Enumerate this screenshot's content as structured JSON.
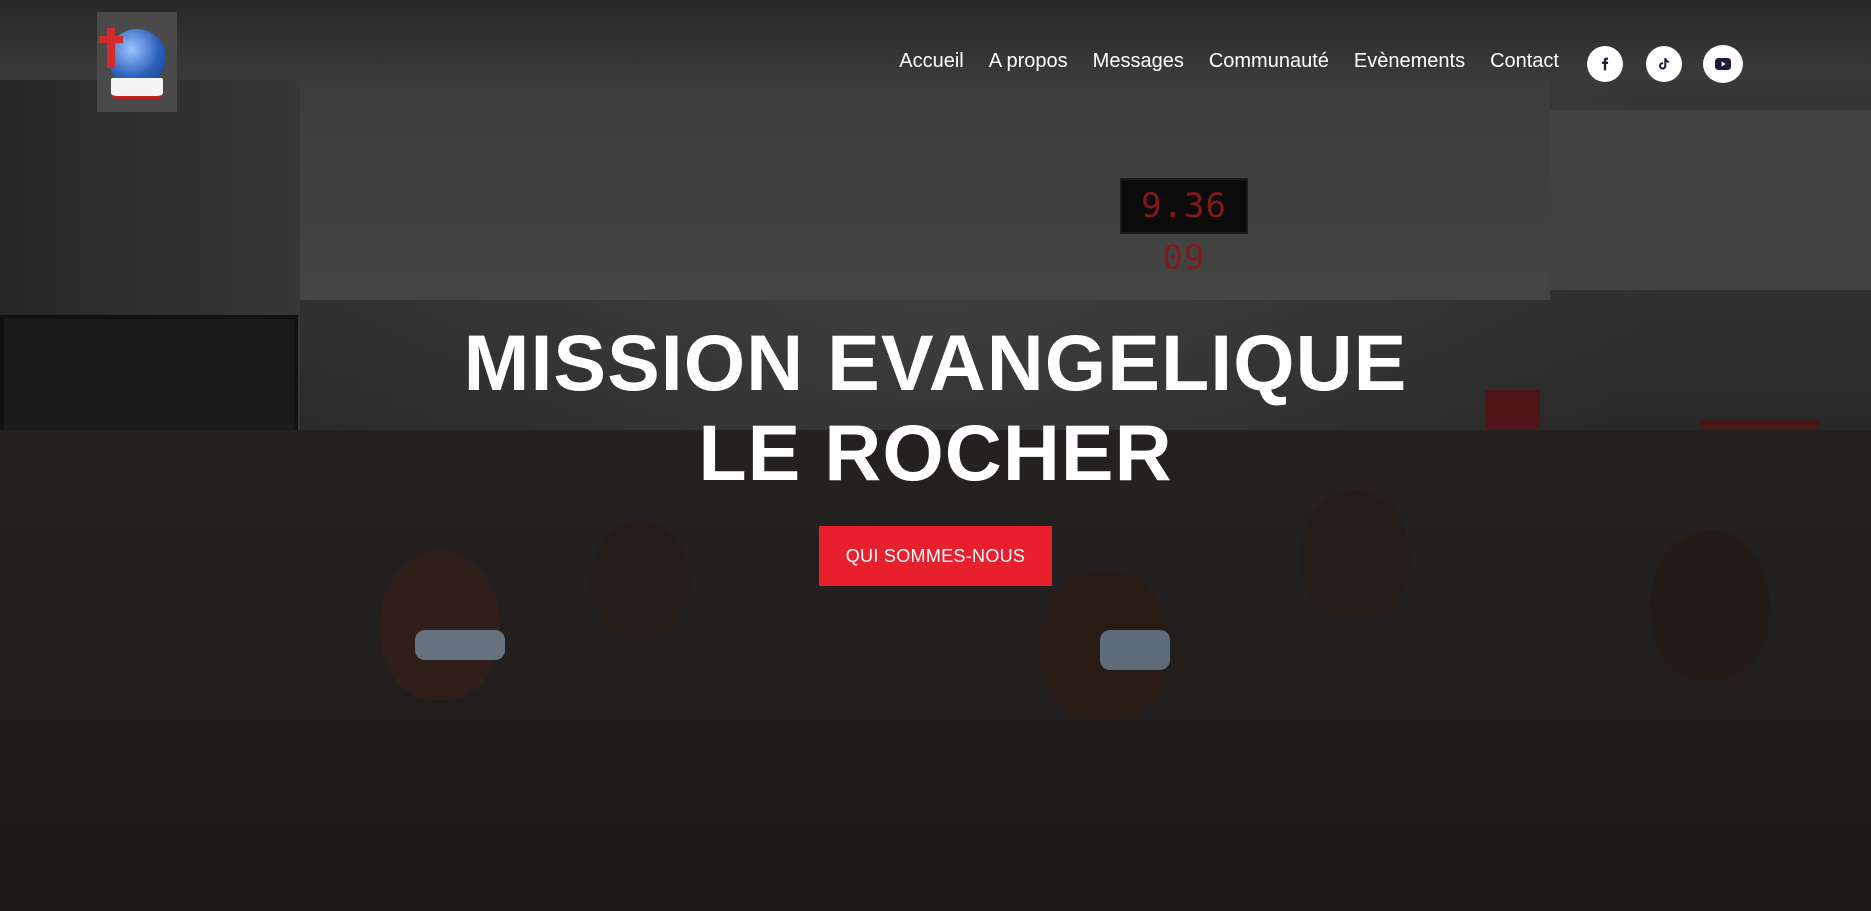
{
  "site": {
    "logo_icon": "globe-cross-bible-logo"
  },
  "nav": {
    "items": [
      {
        "label": "Accueil"
      },
      {
        "label": "A propos"
      },
      {
        "label": "Messages"
      },
      {
        "label": "Communauté"
      },
      {
        "label": "Evènements"
      },
      {
        "label": "Contact"
      }
    ]
  },
  "socials": [
    {
      "icon": "facebook-icon"
    },
    {
      "icon": "tiktok-icon"
    },
    {
      "icon": "youtube-icon"
    }
  ],
  "background": {
    "clock_text": "9.36 09"
  },
  "hero": {
    "title_line1": "MISSION EVANGELIQUE",
    "title_line2": "LE ROCHER",
    "cta_label": "QUI SOMMES-NOUS"
  },
  "colors": {
    "accent": "#e8202e",
    "text": "#ffffff",
    "social_bg": "#ffffff",
    "social_icon": "#1b1b3a"
  }
}
